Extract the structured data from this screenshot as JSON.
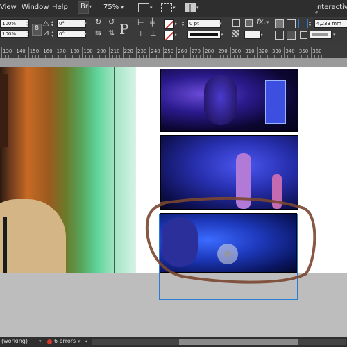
{
  "menubar": {
    "items": [
      "View",
      "Window",
      "Help"
    ],
    "zoom": "75%",
    "workspace": "Interactive f"
  },
  "control_panel": {
    "scale_x": "100%",
    "scale_y": "100%",
    "rotate": "0°",
    "shear": "0°",
    "stroke_weight": "0 pt",
    "width_value": "4,233 mm",
    "fx_label": "fx."
  },
  "ruler": {
    "ticks": [
      "130",
      "140",
      "150",
      "160",
      "170",
      "180",
      "190",
      "200",
      "210",
      "220",
      "230",
      "240",
      "250",
      "260",
      "270",
      "280",
      "290",
      "300",
      "310",
      "320",
      "330",
      "340",
      "350",
      "360"
    ]
  },
  "images": [
    {
      "alt": "woman face, blue light"
    },
    {
      "alt": "singer on stage"
    },
    {
      "alt": "singer with microphone"
    }
  ],
  "status": {
    "profile": "(working)",
    "errors": "6 errors"
  },
  "colors": {
    "accent": "#2a7bd3",
    "error": "#d23a2a",
    "annotation": "#7a4630"
  }
}
